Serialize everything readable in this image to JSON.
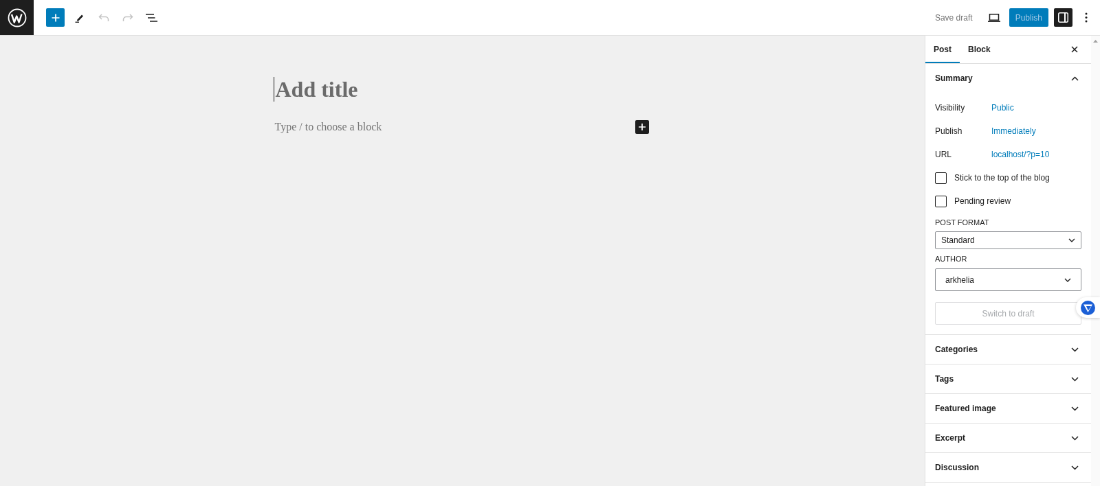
{
  "top_bar": {
    "tools": [
      {
        "kind": "inserter",
        "disabled": false
      },
      {
        "kind": "edit",
        "disabled": false
      },
      {
        "kind": "undo",
        "disabled": true
      },
      {
        "kind": "redo",
        "disabled": true
      },
      {
        "kind": "outline",
        "disabled": false
      }
    ],
    "save_draft": "Save draft",
    "publish": {
      "label": "Publish",
      "disabled": true
    },
    "settings": {
      "pressed": true
    }
  },
  "editor": {
    "title": {
      "placeholder": "Add title"
    },
    "block": {
      "placeholder": "Type / to choose a block"
    }
  },
  "sidebar": {
    "tabs": [
      {
        "label": "Post",
        "selected": true
      },
      {
        "label": "Block",
        "selected": false
      }
    ],
    "panels": [
      {
        "title": "Summary",
        "expanded": true,
        "rows": [
          {
            "label": "Visibility",
            "value": "Public"
          },
          {
            "label": "Publish",
            "value": "Immediately"
          },
          {
            "label": "URL",
            "value": "localhost/?p=10"
          }
        ],
        "checkboxes": [
          {
            "label": "Stick to the top of the blog",
            "checked": false
          },
          {
            "label": "Pending review",
            "checked": false
          }
        ],
        "selects": [
          {
            "kind": "select",
            "label": "POST FORMAT",
            "value": "Standard"
          },
          {
            "kind": "combobox",
            "label": "AUTHOR",
            "value": "arkhelia"
          }
        ],
        "button": {
          "label": "Switch to draft",
          "disabled": true
        }
      },
      {
        "title": "Categories",
        "expanded": false
      },
      {
        "title": "Tags",
        "expanded": false
      },
      {
        "title": "Featured image",
        "expanded": false
      },
      {
        "title": "Excerpt",
        "expanded": false
      },
      {
        "title": "Discussion",
        "expanded": false
      }
    ]
  }
}
